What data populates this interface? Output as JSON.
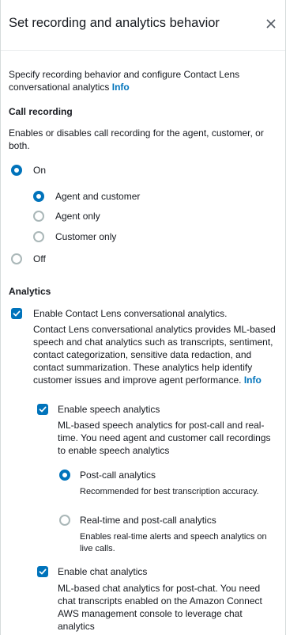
{
  "panel": {
    "title": "Set recording and analytics behavior",
    "close_icon": "close-icon"
  },
  "intro": {
    "text_line1": "Specify recording behavior and configure Contact Lens",
    "text_line2": "conversational analytics",
    "info_link": "Info"
  },
  "call_recording": {
    "heading": "Call recording",
    "desc_line1": "Enables or disables call recording for the agent, customer, or",
    "desc_line2": "both.",
    "on_label": "On",
    "options": [
      {
        "label": "Agent and customer",
        "selected": true
      },
      {
        "label": "Agent only",
        "selected": false
      },
      {
        "label": "Customer only",
        "selected": false
      }
    ],
    "off_label": "Off"
  },
  "analytics": {
    "heading": "Analytics",
    "enable_contact_lens": "Enable Contact Lens conversational analytics.",
    "contact_lens_desc": [
      "Contact Lens conversational analytics provides ML-based",
      "speech and chat analytics such as transcripts, sentiment,",
      "contact categorization, sensitive data redaction, and",
      "contact summarization. These analytics help identify",
      "customer issues and improve agent performance."
    ],
    "contact_lens_info": "Info",
    "speech": {
      "label": "Enable speech analytics",
      "desc": [
        "ML-based speech analytics for post-call and real-",
        "time. You need agent and customer call recordings",
        "to enable speech analytics"
      ],
      "post_call_label": "Post-call analytics",
      "post_call_desc": "Recommended for best transcription accuracy.",
      "realtime_label": "Real-time and post-call analytics",
      "realtime_desc": [
        "Enables real-time alerts and speech analytics on",
        "live calls."
      ]
    },
    "chat": {
      "label": "Enable chat analytics",
      "desc": [
        "ML-based chat analytics for post-chat. You need",
        "chat transcripts enabled on the Amazon Connect",
        "AWS management console to leverage chat",
        "analytics"
      ]
    }
  },
  "colors": {
    "accent": "#0073bb",
    "text": "#16191f",
    "radio_border": "#aab7b8"
  }
}
